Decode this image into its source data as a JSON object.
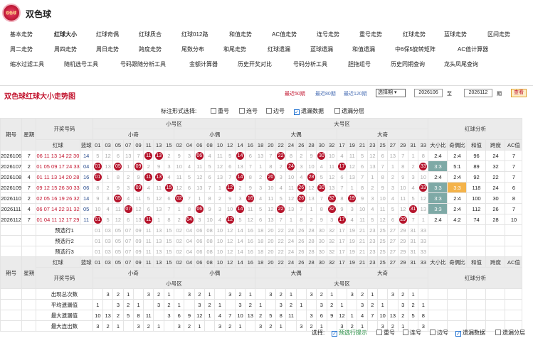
{
  "app": {
    "title": "双色球",
    "logo_text": "双色球"
  },
  "nav": [
    [
      "基本走势",
      "红球大小",
      "红球奇偶",
      "红球质合",
      "红球012路",
      "和值走势",
      "AC值走势",
      "连号走势",
      "重号走势",
      "红球走势",
      "蓝球走势",
      "区间走势"
    ],
    [
      "周二走势",
      "周四走势",
      "周日走势",
      "跨度走势",
      "尾数分布",
      "和尾走势",
      "红球遗漏",
      "蓝球遗漏",
      "和值遗漏",
      "中6保5旋转矩阵",
      "AC值计算器"
    ],
    [
      "缩水过滤工具",
      "随机选号工具",
      "号码跟随分析工具",
      "金额计算器",
      "历史开奖对比",
      "号码分析工具",
      "胆拖组号",
      "历史同期查询",
      "龙头凤尾查询"
    ]
  ],
  "panel": {
    "title": "双色球红球大小走势图",
    "recent50": "最近50期",
    "recent80": "最近80期",
    "recent120": "最近120期",
    "select": "选择期",
    "from": "2026106",
    "to": "2026112",
    "lbl_to": "至",
    "lbl_qi": "期",
    "query": "查看"
  },
  "opts": {
    "label": "标注形式选择:",
    "items": [
      "重号",
      "连号",
      "边号",
      "遗漏数据",
      "遗漏分层"
    ],
    "checked": [
      false,
      false,
      false,
      true,
      false
    ]
  },
  "head": {
    "qihao": "期号",
    "xingqi": "星期",
    "kj": "开奖号码",
    "hong": "红球",
    "lan": "蓝球",
    "xiao": "小号区",
    "da": "大号区",
    "xq": "小奇",
    "xo": "小偶",
    "dq": "大偶",
    "dj": "大奇",
    "fx": "红球分析",
    "fxc": [
      "大小比",
      "奇偶比",
      "和值",
      "跨度",
      "AC值"
    ],
    "nums_x1": [
      "01",
      "03",
      "05",
      "07",
      "09",
      "11",
      "13",
      "15"
    ],
    "nums_x2": [
      "02",
      "04",
      "06",
      "08",
      "10",
      "12",
      "14",
      "16"
    ],
    "nums_d1": [
      "18",
      "20",
      "22",
      "24",
      "26",
      "28",
      "30",
      "32"
    ],
    "nums_d2": [
      "17",
      "19",
      "21",
      "23",
      "25",
      "27",
      "29",
      "31",
      "33"
    ]
  },
  "rows": [
    {
      "q": "2026106",
      "w": "7",
      "r": "06 11 13 14 22 30",
      "b": "14",
      "fx": [
        "2:4",
        "2:4",
        "96",
        "24",
        "7"
      ]
    },
    {
      "q": "2026107",
      "w": "2",
      "r": "01 05 09 17 24 33",
      "b": "04",
      "fx": [
        "3:3",
        "5:1",
        "89",
        "32",
        "7"
      ]
    },
    {
      "q": "2026108",
      "w": "4",
      "r": "01 11 13 14 20 28",
      "b": "16",
      "fx": [
        "2:4",
        "2:4",
        "92",
        "22",
        "7"
      ]
    },
    {
      "q": "2026109",
      "w": "7",
      "r": "09 12 15 26 30 33",
      "b": "06",
      "fx": [
        "3:3",
        "3:3",
        "118",
        "24",
        "6"
      ]
    },
    {
      "q": "2026110",
      "w": "2",
      "r": "02 05 16 19 26 32",
      "b": "14",
      "fx": [
        "3:3",
        "2:4",
        "100",
        "30",
        "8"
      ]
    },
    {
      "q": "2026111",
      "w": "4",
      "r": "06 07 14 22 31 32",
      "b": "05",
      "fx": [
        "3:3",
        "2:4",
        "112",
        "26",
        "7"
      ]
    },
    {
      "q": "2026112",
      "w": "7",
      "r": "01 04 11 12 17 29",
      "b": "11",
      "fx": [
        "2:4",
        "4:2",
        "74",
        "28",
        "10"
      ]
    }
  ],
  "pre": [
    "预选行1",
    "预选行2",
    "预选行3"
  ],
  "stats": [
    "出现总次数",
    "平均遗漏值",
    "最大遗漏值",
    "最大连出数"
  ],
  "foot": {
    "label": "选择:",
    "items": [
      "预选行提示",
      "重号",
      "连号",
      "边号",
      "遗漏数据",
      "遗漏分层"
    ],
    "checked": [
      true,
      false,
      false,
      false,
      true,
      false
    ]
  }
}
